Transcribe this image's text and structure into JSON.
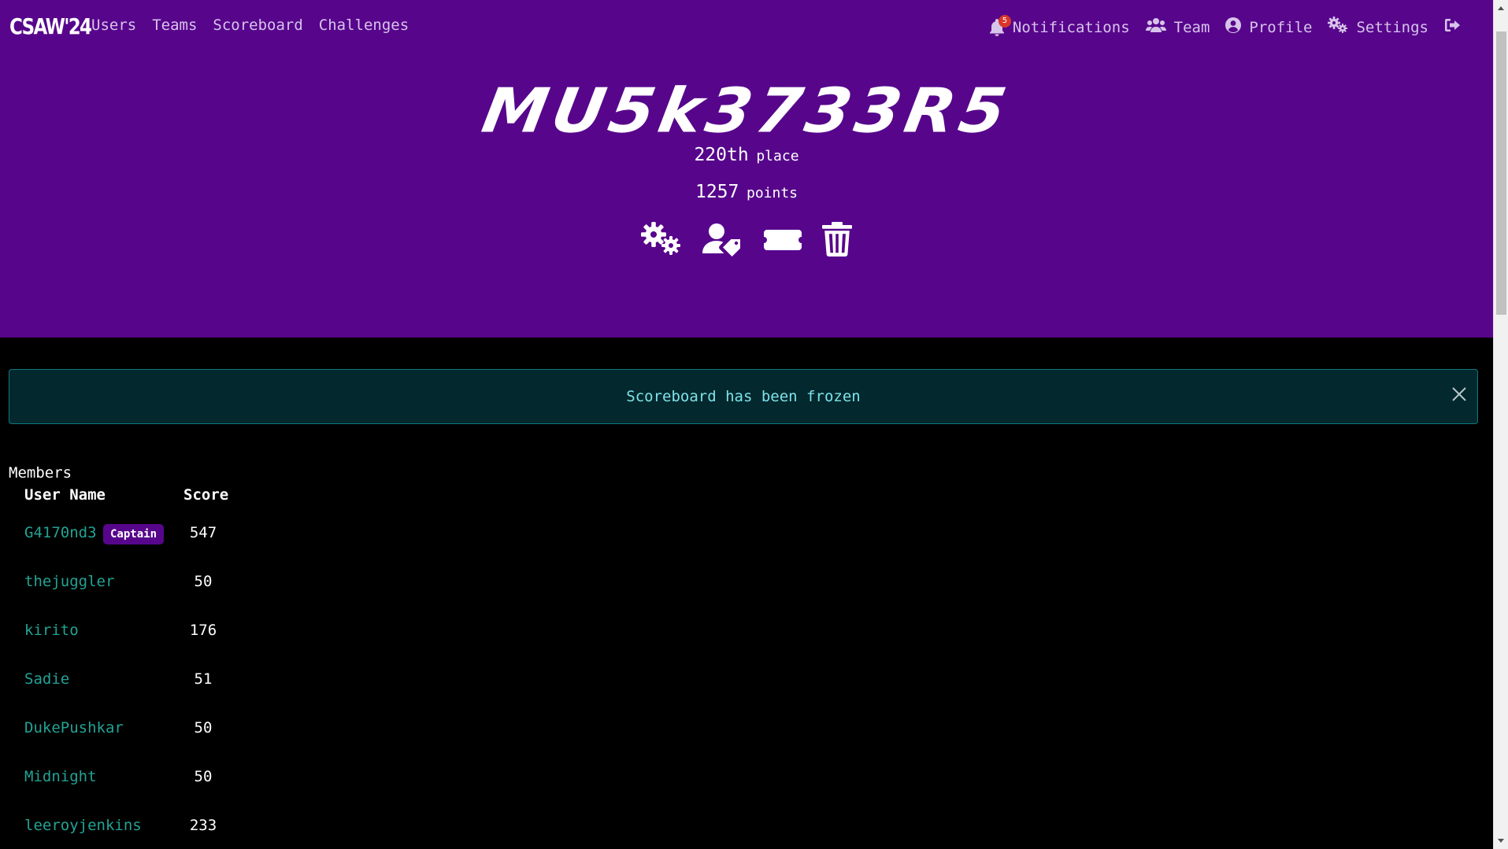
{
  "nav": {
    "brand": "CSAW'24",
    "links": [
      "Users",
      "Teams",
      "Scoreboard",
      "Challenges"
    ],
    "notifications_label": "Notifications",
    "notifications_count": "5",
    "team_label": "Team",
    "profile_label": "Profile",
    "settings_label": "Settings"
  },
  "team": {
    "name": "MU5k3733R5",
    "place_value": "220th",
    "place_label": "place",
    "points_value": "1257",
    "points_label": "points"
  },
  "alert": {
    "message": "Scoreboard has been frozen"
  },
  "members": {
    "title": "Members",
    "headers": {
      "user": "User Name",
      "score": "Score"
    },
    "captain_label": "Captain",
    "rows": [
      {
        "name": "G4170nd3",
        "score": "547",
        "captain": true
      },
      {
        "name": "thejuggler",
        "score": "50",
        "captain": false
      },
      {
        "name": "kirito",
        "score": "176",
        "captain": false
      },
      {
        "name": "Sadie",
        "score": "51",
        "captain": false
      },
      {
        "name": "DukePushkar",
        "score": "50",
        "captain": false
      },
      {
        "name": "Midnight",
        "score": "50",
        "captain": false
      },
      {
        "name": "leeroyjenkins",
        "score": "233",
        "captain": false
      }
    ]
  },
  "colors": {
    "header_purple": "#57068c",
    "link_teal": "#22a294",
    "alert_bg": "#03282d",
    "alert_text": "#7de3eb"
  }
}
